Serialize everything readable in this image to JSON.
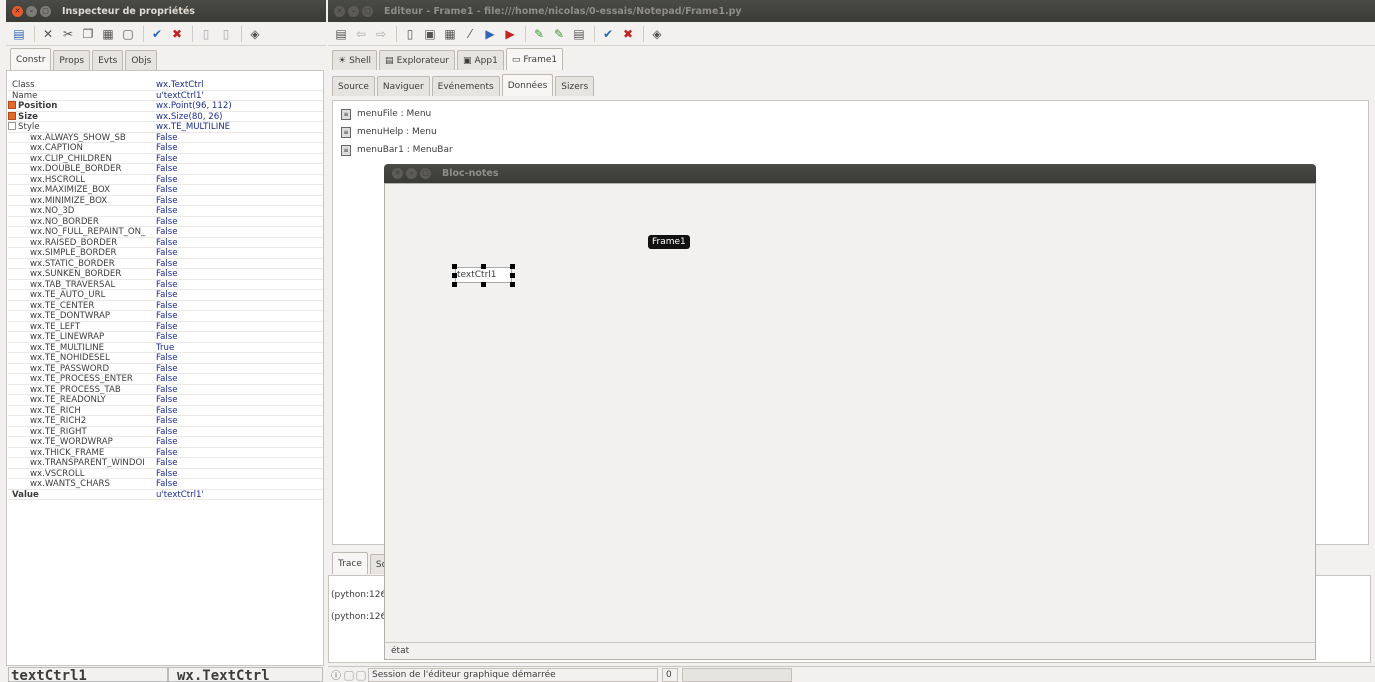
{
  "inspector": {
    "title": "Inspecteur de propriétés",
    "tabs": [
      "Constr",
      "Props",
      "Evts",
      "Objs"
    ],
    "properties": [
      {
        "name": "Class",
        "value": "wx.TextCtrl",
        "style": "plain"
      },
      {
        "name": "Name",
        "value": "u'textCtrl1'",
        "style": "plain"
      },
      {
        "name": "Position",
        "value": "wx.Point(96, 112)",
        "style": "checked"
      },
      {
        "name": "Size",
        "value": "wx.Size(80, 26)",
        "style": "checked"
      },
      {
        "name": "Style",
        "value": "wx.TE_MULTILINE",
        "style": "unchecked"
      },
      {
        "name": "wx.ALWAYS_SHOW_SB",
        "value": "False",
        "style": "sub"
      },
      {
        "name": "wx.CAPTION",
        "value": "False",
        "style": "sub"
      },
      {
        "name": "wx.CLIP_CHILDREN",
        "value": "False",
        "style": "sub"
      },
      {
        "name": "wx.DOUBLE_BORDER",
        "value": "False",
        "style": "sub"
      },
      {
        "name": "wx.HSCROLL",
        "value": "False",
        "style": "sub"
      },
      {
        "name": "wx.MAXIMIZE_BOX",
        "value": "False",
        "style": "sub"
      },
      {
        "name": "wx.MINIMIZE_BOX",
        "value": "False",
        "style": "sub"
      },
      {
        "name": "wx.NO_3D",
        "value": "False",
        "style": "sub"
      },
      {
        "name": "wx.NO_BORDER",
        "value": "False",
        "style": "sub"
      },
      {
        "name": "wx.NO_FULL_REPAINT_ON_",
        "value": "False",
        "style": "sub"
      },
      {
        "name": "wx.RAISED_BORDER",
        "value": "False",
        "style": "sub"
      },
      {
        "name": "wx.SIMPLE_BORDER",
        "value": "False",
        "style": "sub"
      },
      {
        "name": "wx.STATIC_BORDER",
        "value": "False",
        "style": "sub"
      },
      {
        "name": "wx.SUNKEN_BORDER",
        "value": "False",
        "style": "sub"
      },
      {
        "name": "wx.TAB_TRAVERSAL",
        "value": "False",
        "style": "sub"
      },
      {
        "name": "wx.TE_AUTO_URL",
        "value": "False",
        "style": "sub"
      },
      {
        "name": "wx.TE_CENTER",
        "value": "False",
        "style": "sub"
      },
      {
        "name": "wx.TE_DONTWRAP",
        "value": "False",
        "style": "sub"
      },
      {
        "name": "wx.TE_LEFT",
        "value": "False",
        "style": "sub"
      },
      {
        "name": "wx.TE_LINEWRAP",
        "value": "False",
        "style": "sub"
      },
      {
        "name": "wx.TE_MULTILINE",
        "value": "True",
        "style": "sub"
      },
      {
        "name": "wx.TE_NOHIDESEL",
        "value": "False",
        "style": "sub"
      },
      {
        "name": "wx.TE_PASSWORD",
        "value": "False",
        "style": "sub"
      },
      {
        "name": "wx.TE_PROCESS_ENTER",
        "value": "False",
        "style": "sub"
      },
      {
        "name": "wx.TE_PROCESS_TAB",
        "value": "False",
        "style": "sub"
      },
      {
        "name": "wx.TE_READONLY",
        "value": "False",
        "style": "sub"
      },
      {
        "name": "wx.TE_RICH",
        "value": "False",
        "style": "sub"
      },
      {
        "name": "wx.TE_RICH2",
        "value": "False",
        "style": "sub"
      },
      {
        "name": "wx.TE_RIGHT",
        "value": "False",
        "style": "sub"
      },
      {
        "name": "wx.TE_WORDWRAP",
        "value": "False",
        "style": "sub"
      },
      {
        "name": "wx.THICK_FRAME",
        "value": "False",
        "style": "sub"
      },
      {
        "name": "wx.TRANSPARENT_WINDOI",
        "value": "False",
        "style": "sub"
      },
      {
        "name": "wx.VSCROLL",
        "value": "False",
        "style": "sub"
      },
      {
        "name": "wx.WANTS_CHARS",
        "value": "False",
        "style": "sub"
      },
      {
        "name": "Value",
        "value": "u'textCtrl1'",
        "style": "bold"
      }
    ],
    "footer": {
      "name": "textCtrl1",
      "class": "wx.TextCtrl"
    }
  },
  "editor": {
    "title": "Editeur - Frame1 - file:///home/nicolas/0-essais/Notepad/Frame1.py",
    "file_tabs": [
      "Shell",
      "Explorateur",
      "App1",
      "Frame1"
    ],
    "view_tabs": [
      "Source",
      "Naviguer",
      "Evénements",
      "Données",
      "Sizers"
    ],
    "objects": [
      "menuFile : Menu",
      "menuHelp : Menu",
      "menuBar1 : MenuBar"
    ],
    "bottom_tabs": [
      "Trace",
      "So"
    ],
    "trace_lines": [
      "(python:126",
      "(python:126"
    ],
    "status": {
      "message": "Session de l'éditeur graphique démarrée",
      "position": "0"
    }
  },
  "designer": {
    "title": "Bloc-notes",
    "tooltip": "Frame1",
    "textctrl": "textCtrl1",
    "status_text": "état"
  },
  "colors": {
    "titlebar": "#3c3b37",
    "close_button": "#e75b2a",
    "value_text": "#1b2d8c"
  }
}
